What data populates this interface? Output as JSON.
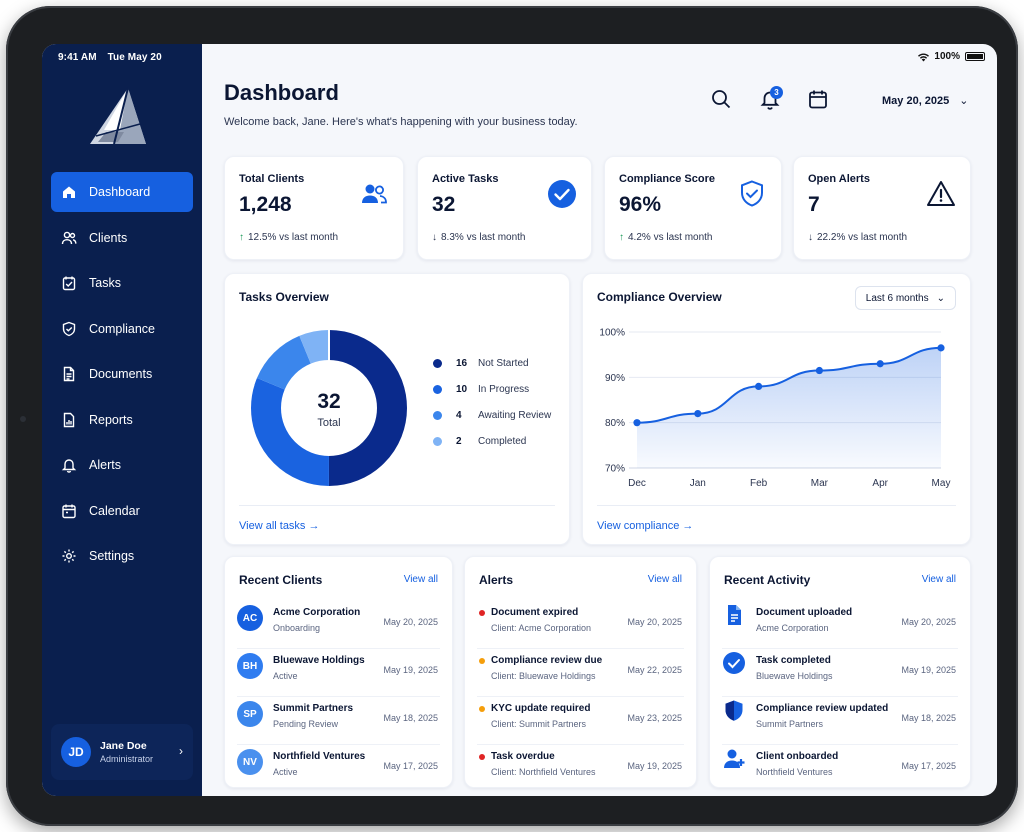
{
  "status": {
    "time": "9:41 AM",
    "day": "Tue May 20",
    "battery": "100%"
  },
  "colors": {
    "sidebar": "#0a1f4e",
    "accent": "#1660e0",
    "success": "#1a9a57",
    "danger": "#e02424",
    "warning": "#f59e0b"
  },
  "nav": {
    "items": [
      {
        "label": "Dashboard",
        "icon": "home-icon"
      },
      {
        "label": "Clients",
        "icon": "users-icon"
      },
      {
        "label": "Tasks",
        "icon": "tasks-icon"
      },
      {
        "label": "Compliance",
        "icon": "shield-icon"
      },
      {
        "label": "Documents",
        "icon": "document-icon"
      },
      {
        "label": "Reports",
        "icon": "report-icon"
      },
      {
        "label": "Alerts",
        "icon": "bell-icon"
      },
      {
        "label": "Calendar",
        "icon": "calendar-icon"
      },
      {
        "label": "Settings",
        "icon": "gear-icon"
      }
    ]
  },
  "user": {
    "initials": "JD",
    "name": "Jane Doe",
    "role": "Administrator"
  },
  "header": {
    "title": "Dashboard",
    "welcome": "Welcome back, Jane. Here's what's happening with your business today.",
    "notif_count": "3",
    "date": "May 20, 2025"
  },
  "kpis": [
    {
      "title": "Total Clients",
      "value": "1,248",
      "arrow": "↑",
      "change": "12.5% vs last month",
      "icon": "users-icon"
    },
    {
      "title": "Active Tasks",
      "value": "32",
      "arrow": "↓",
      "change": "8.3% vs last month",
      "icon": "check-circle-icon"
    },
    {
      "title": "Compliance Score",
      "value": "96%",
      "arrow": "↑",
      "change": "4.2% vs last month",
      "icon": "shield-check-icon"
    },
    {
      "title": "Open Alerts",
      "value": "7",
      "arrow": "↓",
      "change": "22.2% vs last month",
      "icon": "warning-icon"
    }
  ],
  "tasks_overview": {
    "title": "Tasks Overview",
    "total": "32",
    "total_label": "Total",
    "link": "View all tasks",
    "legend": [
      {
        "count": "16",
        "label": "Not Started",
        "color": "#0a2a8c"
      },
      {
        "count": "10",
        "label": "In Progress",
        "color": "#1a63e0"
      },
      {
        "count": "4",
        "label": "Awaiting Review",
        "color": "#3b86ec"
      },
      {
        "count": "2",
        "label": "Completed",
        "color": "#7fb3f5"
      }
    ]
  },
  "compliance_overview": {
    "title": "Compliance Overview",
    "range": "Last 6 months",
    "link": "View compliance"
  },
  "chart_data": {
    "type": "area",
    "categories": [
      "Dec",
      "Jan",
      "Feb",
      "Mar",
      "Apr",
      "May"
    ],
    "values": [
      80,
      82,
      88,
      91.5,
      93,
      96.5
    ],
    "ylim": [
      70,
      100
    ],
    "yticks": [
      "70%",
      "80%",
      "90%",
      "100%"
    ],
    "title": "Compliance Overview",
    "xlabel": "",
    "ylabel": "",
    "grid": true
  },
  "recent_clients": {
    "title": "Recent Clients",
    "view_all": "View all",
    "rows": [
      {
        "initials": "AC",
        "name": "Acme Corporation",
        "status": "Onboarding",
        "date": "May 20, 2025",
        "color": "#1660e0"
      },
      {
        "initials": "BH",
        "name": "Bluewave Holdings",
        "status": "Active",
        "date": "May 19, 2025",
        "color": "#2f7cf0"
      },
      {
        "initials": "SP",
        "name": "Summit Partners",
        "status": "Pending Review",
        "date": "May 18, 2025",
        "color": "#3b86ec"
      },
      {
        "initials": "NV",
        "name": "Northfield Ventures",
        "status": "Active",
        "date": "May 17, 2025",
        "color": "#4a90ee"
      }
    ]
  },
  "alerts": {
    "title": "Alerts",
    "view_all": "View all",
    "rows": [
      {
        "title": "Document expired",
        "client": "Client: Acme Corporation",
        "date": "May 20, 2025",
        "color": "#e02424"
      },
      {
        "title": "Compliance review due",
        "client": "Client: Bluewave Holdings",
        "date": "May 22, 2025",
        "color": "#f59e0b"
      },
      {
        "title": "KYC update required",
        "client": "Client: Summit Partners",
        "date": "May 23, 2025",
        "color": "#f59e0b"
      },
      {
        "title": "Task overdue",
        "client": "Client: Northfield Ventures",
        "date": "May 19, 2025",
        "color": "#e02424"
      }
    ]
  },
  "recent_activity": {
    "title": "Recent Activity",
    "view_all": "View all",
    "rows": [
      {
        "title": "Document uploaded",
        "sub": "Acme Corporation",
        "date": "May 20, 2025",
        "icon": "document-icon"
      },
      {
        "title": "Task completed",
        "sub": "Bluewave Holdings",
        "date": "May 19, 2025",
        "icon": "check-circle-icon"
      },
      {
        "title": "Compliance review updated",
        "sub": "Summit Partners",
        "date": "May 18, 2025",
        "icon": "shield-icon"
      },
      {
        "title": "Client onboarded",
        "sub": "Northfield Ventures",
        "date": "May 17, 2025",
        "icon": "user-add-icon"
      }
    ]
  }
}
